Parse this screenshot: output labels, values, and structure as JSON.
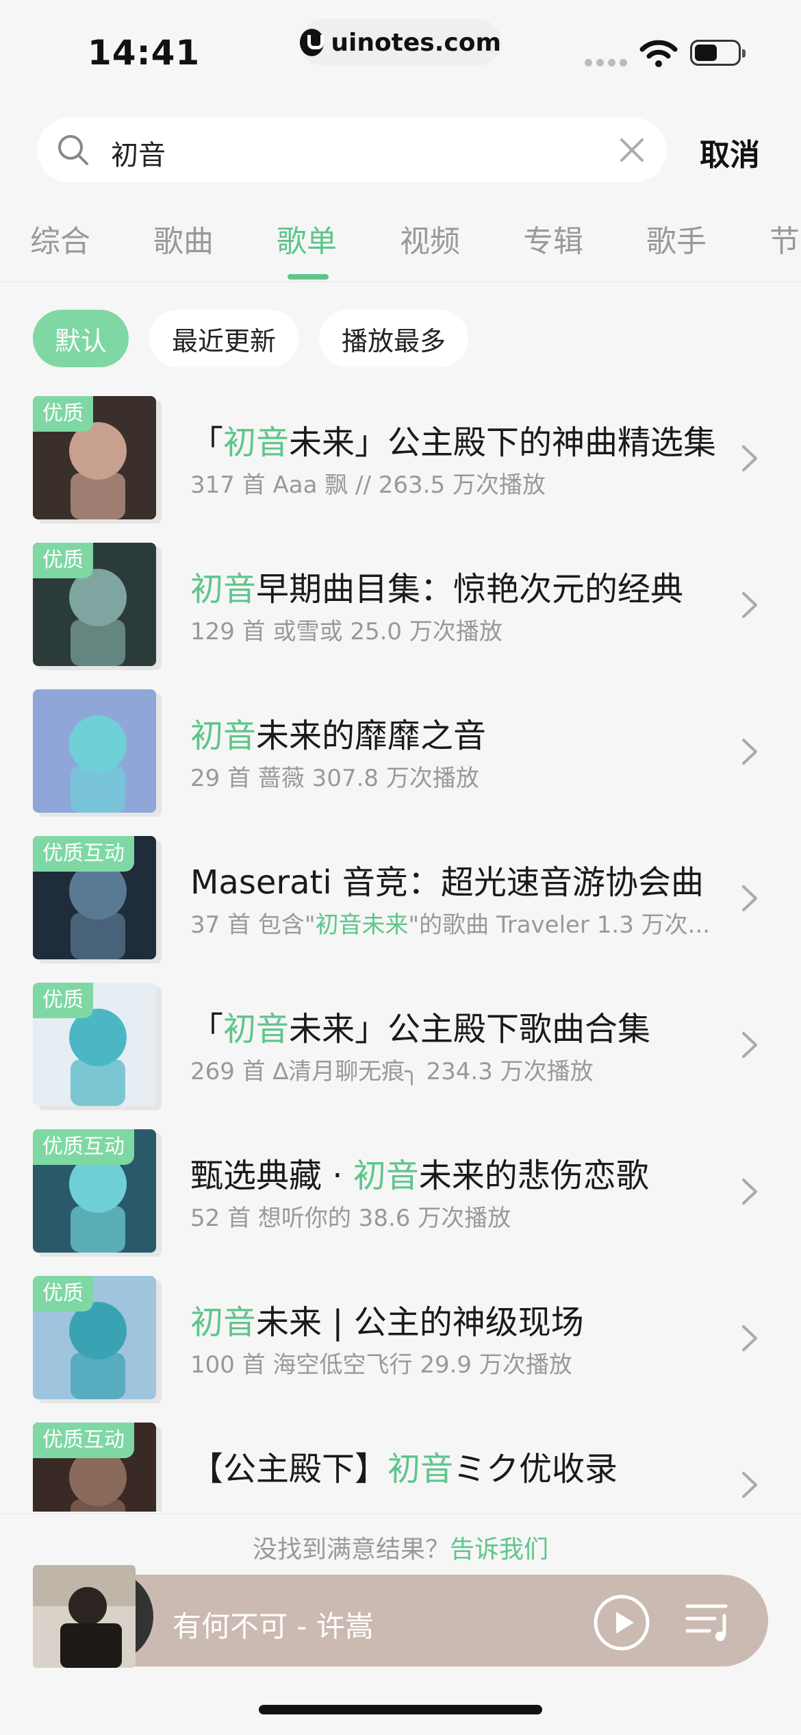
{
  "status": {
    "time": "14:41",
    "url": "uinotes.com"
  },
  "search": {
    "query": "初音",
    "cancel_label": "取消"
  },
  "tabs": [
    "综合",
    "歌曲",
    "歌单",
    "视频",
    "专辑",
    "歌手",
    "节"
  ],
  "active_tab": "歌单",
  "filters": [
    "默认",
    "最近更新",
    "播放最多"
  ],
  "active_filter": "默认",
  "accent_color": "#5ec58c",
  "playlists": [
    {
      "badge": "优质",
      "title_pre": "「",
      "title_hl": "初音",
      "title_post": "未来」公主殿下的神曲精选集",
      "meta_pre": "317 首  Aaa   飘 //  263.5 万次播放",
      "meta_hl": "",
      "meta_post": ""
    },
    {
      "badge": "优质",
      "title_pre": "",
      "title_hl": "初音",
      "title_post": "早期曲目集：惊艳次元的经典",
      "meta_pre": "129 首  或雪或  25.0 万次播放",
      "meta_hl": "",
      "meta_post": ""
    },
    {
      "badge": "",
      "title_pre": "",
      "title_hl": "初音",
      "title_post": "未来的靡靡之音",
      "meta_pre": "29 首  蔷薇  307.8 万次播放",
      "meta_hl": "",
      "meta_post": ""
    },
    {
      "badge": "优质互动",
      "title_pre": "Maserati 音竞：超光速音游协会曲",
      "title_hl": "",
      "title_post": "",
      "meta_pre": "37 首  包含\"",
      "meta_hl": "初音未来",
      "meta_post": "\"的歌曲 Traveler  1.3 万次..."
    },
    {
      "badge": "优质",
      "title_pre": "「",
      "title_hl": "初音",
      "title_post": "未来」公主殿下歌曲合集",
      "meta_pre": "269 首  ∆清月聊无痕╮  234.3 万次播放",
      "meta_hl": "",
      "meta_post": ""
    },
    {
      "badge": "优质互动",
      "title_pre": "甄选典藏 · ",
      "title_hl": "初音",
      "title_post": "未来的悲伤恋歌",
      "meta_pre": "52 首  想听你的  38.6 万次播放",
      "meta_hl": "",
      "meta_post": ""
    },
    {
      "badge": "优质",
      "title_pre": "",
      "title_hl": "初音",
      "title_post": "未来 | 公主的神级现场",
      "meta_pre": "100 首  海空低空飞行  29.9 万次播放",
      "meta_hl": "",
      "meta_post": ""
    },
    {
      "badge": "优质互动",
      "title_pre": "【公主殿下】",
      "title_hl": "初音",
      "title_post": "ミク优收录",
      "meta_pre": "",
      "meta_hl": "",
      "meta_post": ""
    }
  ],
  "feedback": {
    "text": "没找到满意结果？",
    "link": "告诉我们"
  },
  "player": {
    "now_playing": "有何不可 - 许嵩"
  }
}
